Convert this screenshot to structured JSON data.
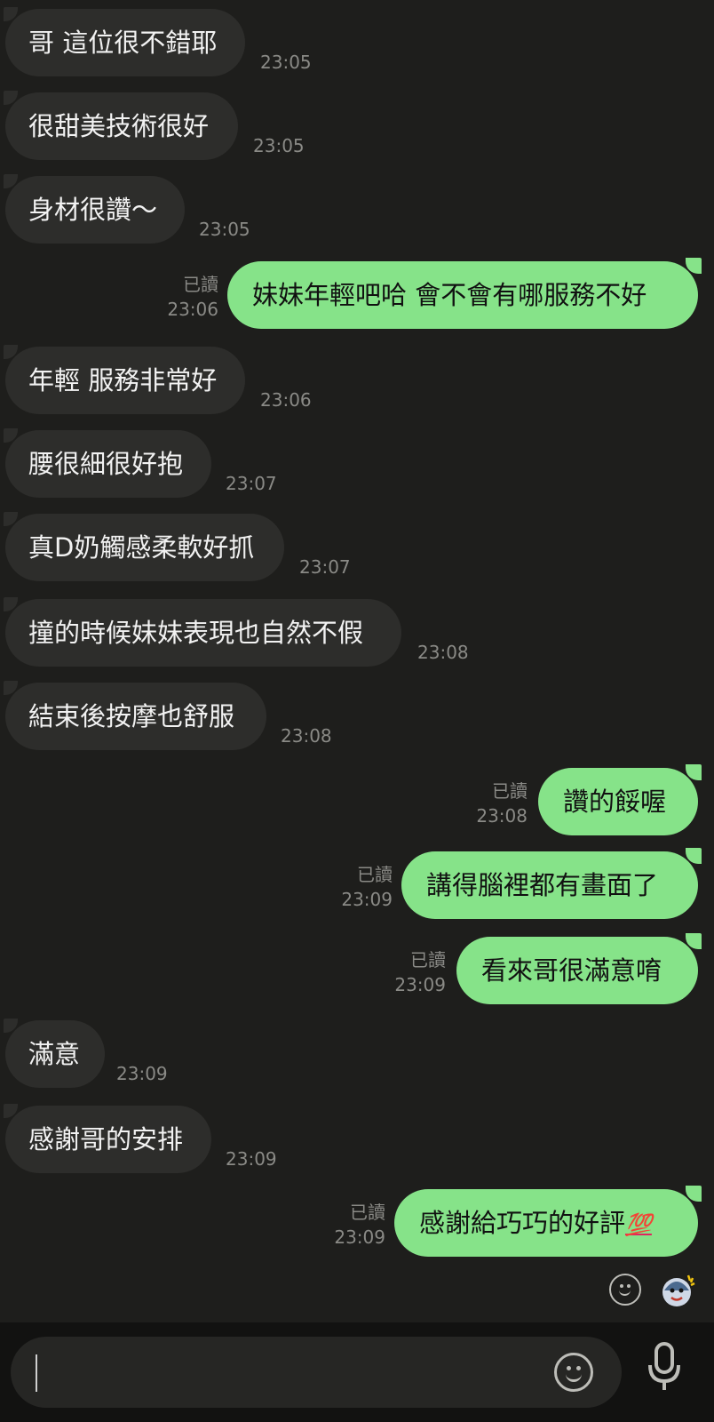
{
  "messages": [
    {
      "dir": "in",
      "text": "哥 這位很不錯耶",
      "time": "23:05"
    },
    {
      "dir": "in",
      "text": "很甜美技術很好",
      "time": "23:05"
    },
    {
      "dir": "in",
      "text": "身材很讚～",
      "time": "23:05"
    },
    {
      "dir": "out",
      "text": "妹妹年輕吧哈 會不會有哪服務不好",
      "read": "已讀",
      "time": "23:06"
    },
    {
      "dir": "in",
      "text": "年輕 服務非常好",
      "time": "23:06"
    },
    {
      "dir": "in",
      "text": "腰很細很好抱",
      "time": "23:07"
    },
    {
      "dir": "in",
      "text": "真D奶觸感柔軟好抓",
      "time": "23:07"
    },
    {
      "dir": "in",
      "text": "撞的時候妹妹表現也自然不假",
      "time": "23:08"
    },
    {
      "dir": "in",
      "text": "結束後按摩也舒服",
      "time": "23:08"
    },
    {
      "dir": "out",
      "text": "讚的餒喔",
      "read": "已讀",
      "time": "23:08"
    },
    {
      "dir": "out",
      "text": "講得腦裡都有畫面了",
      "read": "已讀",
      "time": "23:09"
    },
    {
      "dir": "out",
      "text": "看來哥很滿意唷",
      "read": "已讀",
      "time": "23:09"
    },
    {
      "dir": "in",
      "text": "滿意",
      "time": "23:09"
    },
    {
      "dir": "in",
      "text": "感謝哥的安排",
      "time": "23:09"
    },
    {
      "dir": "out",
      "text": "感謝給巧巧的好評",
      "emoji": "💯",
      "read": "已讀",
      "time": "23:09"
    }
  ],
  "input": {
    "value": ""
  },
  "icons": {
    "quick_emoji": "emoji-icon",
    "sticker": "sticker-icon",
    "input_emoji": "emoji-icon",
    "voice": "microphone-icon"
  },
  "colors": {
    "background": "#1e1e1c",
    "incoming_bubble": "#2d2d2b",
    "outgoing_bubble": "#86e389",
    "meta_text": "#8a8a86"
  }
}
